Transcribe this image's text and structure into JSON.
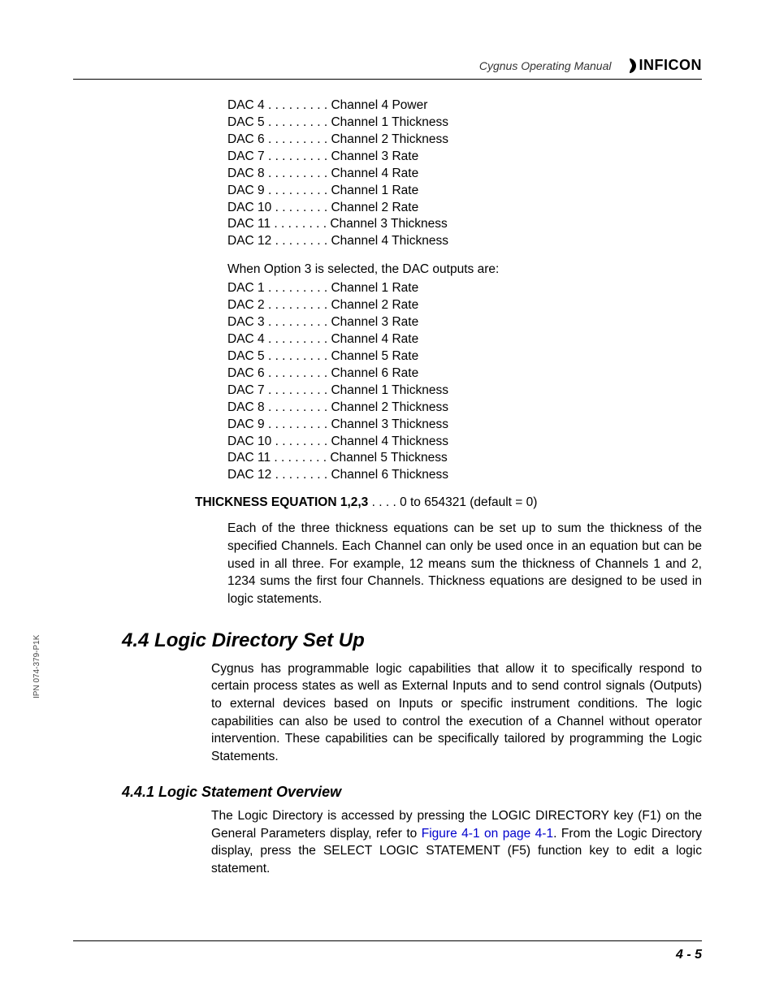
{
  "header": {
    "manual_title": "Cygnus Operating Manual",
    "brand": "INFICON"
  },
  "dac_block1": [
    "DAC 4 . . . . . . . . . Channel 4 Power",
    "DAC 5 . . . . . . . . . Channel 1 Thickness",
    "DAC 6 . . . . . . . . . Channel 2 Thickness",
    "DAC 7 . . . . . . . . . Channel 3 Rate",
    "DAC 8 . . . . . . . . . Channel 4 Rate",
    "DAC 9 . . . . . . . . . Channel 1 Rate",
    "DAC 10 . . . . . . . . Channel 2 Rate",
    "DAC 11 . . . . . . . . Channel 3 Thickness",
    "DAC 12 . . . . . . . . Channel 4 Thickness"
  ],
  "option3_intro": "When Option 3 is selected, the DAC outputs are:",
  "dac_block2": [
    "DAC 1 . . . . . . . . . Channel 1 Rate",
    "DAC 2 . . . . . . . . . Channel 2 Rate",
    "DAC 3 . . . . . . . . . Channel 3 Rate",
    "DAC 4 . . . . . . . . . Channel 4 Rate",
    "DAC 5 . . . . . . . . . Channel 5 Rate",
    "DAC 6 . . . . . . . . . Channel 6 Rate",
    "DAC 7 . . . . . . . . . Channel 1 Thickness",
    "DAC 8 . . . . . . . . . Channel 2 Thickness",
    "DAC 9 . . . . . . . . . Channel 3 Thickness",
    "DAC 10 . . . . . . . . Channel 4 Thickness",
    "DAC 11 . . . . . . . . Channel 5 Thickness",
    "DAC 12 . . . . . . . . Channel 6 Thickness"
  ],
  "param": {
    "name": "THICKNESS EQUATION 1,2,3",
    "range": " . . . . 0 to 654321 (default = 0)",
    "desc": "Each of the three thickness equations can be set up to sum the thickness of the specified Channels. Each Channel can only be used once in an equation but can be used in all three. For example, 12 means sum the thickness of Channels 1 and 2, 1234 sums the first four Channels. Thickness equations are designed to be used in logic statements."
  },
  "section": {
    "num_title": "4.4  Logic Directory Set Up",
    "body": "Cygnus has programmable logic capabilities that allow it to specifically respond to certain process states as well as External Inputs and to send control signals (Outputs) to external devices based on Inputs or specific instrument conditions. The logic capabilities can also be used to control the execution of a Channel without operator intervention. These capabilities can be specifically tailored by programming the Logic Statements."
  },
  "subsection": {
    "num_title": "4.4.1  Logic Statement Overview",
    "body_pre": "The Logic Directory is accessed by pressing the LOGIC DIRECTORY key (F1) on the General Parameters display, refer to ",
    "link": "Figure 4-1 on page 4-1",
    "body_post": ". From the Logic Directory display, press the SELECT LOGIC STATEMENT (F5) function key to edit a logic statement."
  },
  "side_label": "IPN 074-379-P1K",
  "page_number": "4 - 5"
}
